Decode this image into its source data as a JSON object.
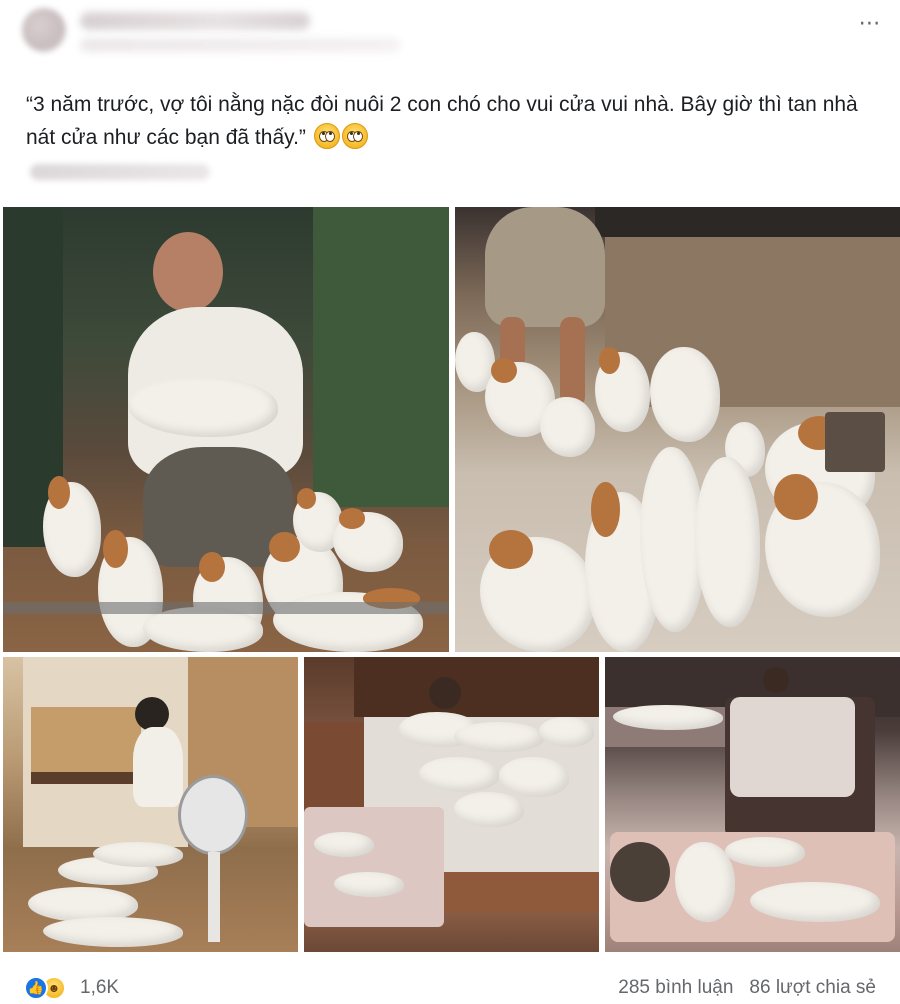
{
  "post": {
    "more_icon": "more-horizontal-icon",
    "caption_text": "“3 năm trước, vợ tôi nằng nặc đòi nuôi 2 con chó cho vui cửa vui nhà. Bây giờ thì tan nhà nát cửa như các bạn đã thấy.”",
    "caption_emojis": [
      "rolling-eyes-emoji",
      "rolling-eyes-emoji"
    ]
  },
  "photos": [
    {
      "icon": "photo-man-with-dogs"
    },
    {
      "icon": "photo-dogs-in-kitchen"
    },
    {
      "icon": "photo-man-at-desk-with-dogs"
    },
    {
      "icon": "photo-man-in-bed-with-dogs"
    },
    {
      "icon": "photo-man-on-couch-with-dogs"
    }
  ],
  "footer": {
    "reaction_icons": [
      "like-icon",
      "haha-icon"
    ],
    "reaction_count": "1,6K",
    "comments": "285 bình luận",
    "shares": "86 lượt chia sẻ"
  },
  "colors": {
    "like_blue": "#1b74e4",
    "muted_text": "#65676b",
    "text": "#1c1e21"
  }
}
